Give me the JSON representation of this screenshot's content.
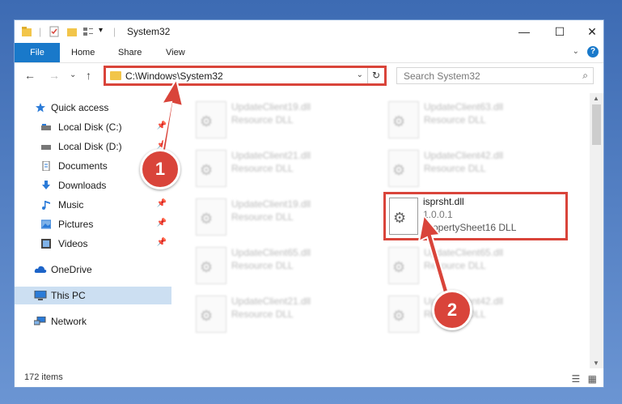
{
  "titlebar": {
    "title": "System32",
    "minimize": "—",
    "maximize": "☐",
    "close": "✕",
    "qa_dropdown": "▾"
  },
  "ribbon": {
    "tabs": [
      "File",
      "Home",
      "Share",
      "View"
    ],
    "help": "?",
    "expand": "⌄"
  },
  "address": {
    "path": "C:\\Windows\\System32",
    "dropdown": "⌄",
    "refresh": "↻"
  },
  "search": {
    "placeholder": "Search System32",
    "icon": "⌕"
  },
  "nav": {
    "back": "←",
    "forward": "→",
    "recent": "⌄",
    "up": "↑"
  },
  "sidebar": {
    "items": [
      {
        "label": "Quick access",
        "icon": "star-icon",
        "pinned": false
      },
      {
        "label": "Local Disk (C:)",
        "icon": "drive-icon",
        "pinned": true
      },
      {
        "label": "Local Disk (D:)",
        "icon": "drive-icon",
        "pinned": true
      },
      {
        "label": "Documents",
        "icon": "document-icon",
        "pinned": true
      },
      {
        "label": "Downloads",
        "icon": "download-icon",
        "pinned": true
      },
      {
        "label": "Music",
        "icon": "music-icon",
        "pinned": true
      },
      {
        "label": "Pictures",
        "icon": "picture-icon",
        "pinned": true
      },
      {
        "label": "Videos",
        "icon": "video-icon",
        "pinned": true
      },
      {
        "label": "OneDrive",
        "icon": "cloud-icon",
        "pinned": false
      },
      {
        "label": "This PC",
        "icon": "computer-icon",
        "pinned": false
      },
      {
        "label": "Network",
        "icon": "network-icon",
        "pinned": false
      }
    ]
  },
  "files": [
    {
      "name": "UpdateClient19.dll",
      "desc": "Resource DLL"
    },
    {
      "name": "UpdateClient63.dll",
      "desc": "Resource DLL"
    },
    {
      "name": "UpdateClient21.dll",
      "desc": "Resource DLL"
    },
    {
      "name": "UpdateClient42.dll",
      "desc": "Resource DLL"
    },
    {
      "name": "UpdateClient19.dll",
      "desc": "Resource DLL"
    },
    {
      "name": "isprsht.dll",
      "version": "1.0.0.1",
      "desc": "PropertySheet16 DLL"
    },
    {
      "name": "UpdateClient65.dll",
      "desc": "Resource DLL"
    },
    {
      "name": "UpdateClient65.dll",
      "desc": "Resource DLL"
    },
    {
      "name": "UpdateClient21.dll",
      "desc": "Resource DLL"
    },
    {
      "name": "UpdateClient42.dll",
      "desc": "Resource DLL"
    }
  ],
  "status": {
    "count": "172 items"
  },
  "callouts": [
    "1",
    "2"
  ],
  "colors": {
    "accent": "#1979ca",
    "highlight": "#d9443a",
    "selected": "#ccdff2"
  }
}
